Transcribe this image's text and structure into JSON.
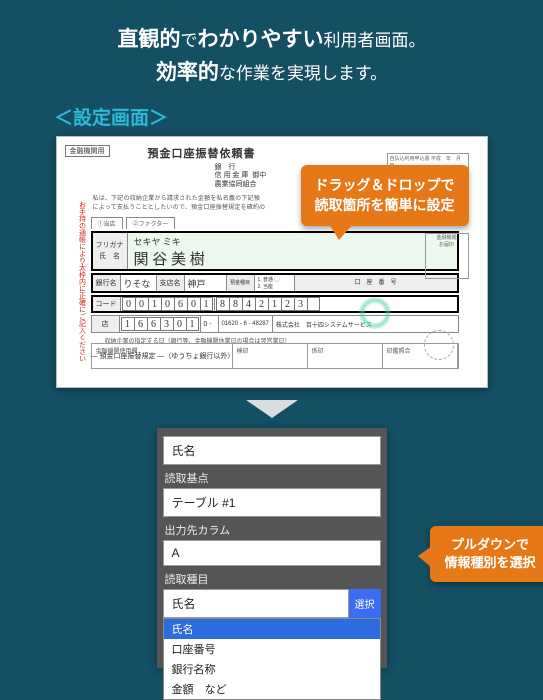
{
  "headline": {
    "p1a": "直観的",
    "p1b": "で",
    "p1c": "わかりやすい",
    "p1d": "利用者画面。",
    "p2a": "効率的",
    "p2b": "な作業を実現します。"
  },
  "section_title": "＜設定画面＞",
  "doc": {
    "corner": "金融機関用",
    "title": "預金口座振替依頼書",
    "banks": "銀　行\n信 用 金 庫  御中\n農業協同組合",
    "note": "私は、下記の収納企業から請求された金額を私名義の下記預\nによって支払うこととしたいので、預金口座振替規定を確約の",
    "tabs": [
      "①当店",
      "②ファクター"
    ],
    "side_red": "お手持の通帳により太枠内に正確にご記入ください",
    "furigana_lbl": "フリガナ",
    "name_lbl": "氏　名",
    "furigana": "セキヤ  ミキ",
    "name_hand": "関 谷  美 樹",
    "bank_lbl": "銀行名",
    "branch_lbl": "支店名",
    "bank": "りそな",
    "branch": "神戸",
    "acct_type_lbl": "預金種目",
    "acct_type": "1. 普通  ◯\n2. 当座",
    "acct_no_lbl": "口　座　番　号",
    "code_lbl": "コード",
    "code_digits": [
      "0",
      "0",
      "1",
      "0",
      "6",
      "0",
      "1"
    ],
    "acct_digits": [
      "8",
      "8",
      "4",
      "2",
      "1",
      "2",
      "3",
      ""
    ],
    "bottom_lbl": "店",
    "bottom_digits": [
      "1",
      "6",
      "6",
      "3",
      "0",
      "1"
    ],
    "bottom_phone": "01620 - 6 - 48287",
    "bottom_company": "株式会社　百十四システムサービス",
    "bottom_note2": "収納企業の指定する日（銀行等、金融機関休業日の場合は翌営業日）",
    "footer_title": "— 預金口座振替規定 —（ゆうちょ銀行以外）",
    "mini": "自払込利用申込書   平成　年　月　日",
    "stamp": "金融機関\nお届印"
  },
  "callout1": {
    "l1": "ドラッグ＆ドロップで",
    "l2": "読取箇所を簡単に設定"
  },
  "panel": {
    "name_lbl": "氏名",
    "basis_lbl": "読取基点",
    "basis_val": "テーブル #1",
    "outcol_lbl": "出力先カラム",
    "outcol_val": "A",
    "kind_lbl": "読取種目",
    "kind_val": "氏名",
    "select_btn": "選択",
    "opts": [
      "氏名",
      "口座番号",
      "銀行名称",
      "金額　など"
    ]
  },
  "callout2": {
    "l1": "プルダウンで",
    "l2": "情報種別を選択"
  }
}
